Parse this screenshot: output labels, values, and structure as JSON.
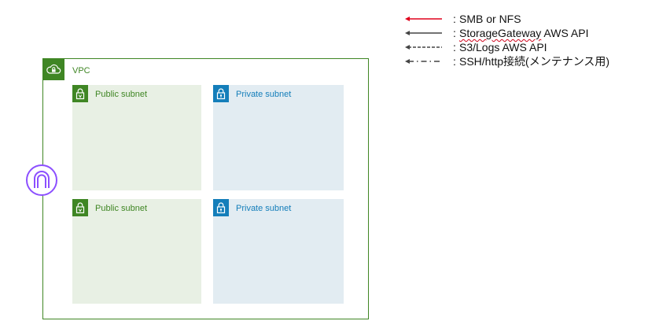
{
  "legend": {
    "items": [
      {
        "label_prefix": "",
        "label_emph": "",
        "label_rest": "SMB or NFS",
        "separator": ":",
        "color": "#e0001b",
        "style": "solid"
      },
      {
        "label_prefix": "",
        "label_emph": "StorageGateway",
        "label_rest": " AWS API",
        "separator": ":",
        "color": "#444444",
        "style": "solid"
      },
      {
        "label_prefix": "",
        "label_emph": "",
        "label_rest": "S3/Logs AWS API",
        "separator": ":",
        "color": "#444444",
        "style": "dashed"
      },
      {
        "label_prefix": "",
        "label_emph": "",
        "label_rest": "SSH/http接続(メンテナンス用)",
        "separator": ":",
        "color": "#444444",
        "style": "dashdot"
      }
    ]
  },
  "vpc": {
    "label": "VPC",
    "color": "#3f8624",
    "icon": "vpc-cloud-lock-icon"
  },
  "subnets": {
    "public_1": {
      "label": "Public subnet",
      "icon": "padlock-icon"
    },
    "private_1": {
      "label": "Private subnet",
      "icon": "padlock-icon"
    },
    "public_2": {
      "label": "Public subnet",
      "icon": "padlock-icon"
    },
    "private_2": {
      "label": "Private subnet",
      "icon": "padlock-icon"
    }
  },
  "internet_gateway": {
    "icon": "internet-gateway-icon",
    "color": "#8c4fff"
  }
}
